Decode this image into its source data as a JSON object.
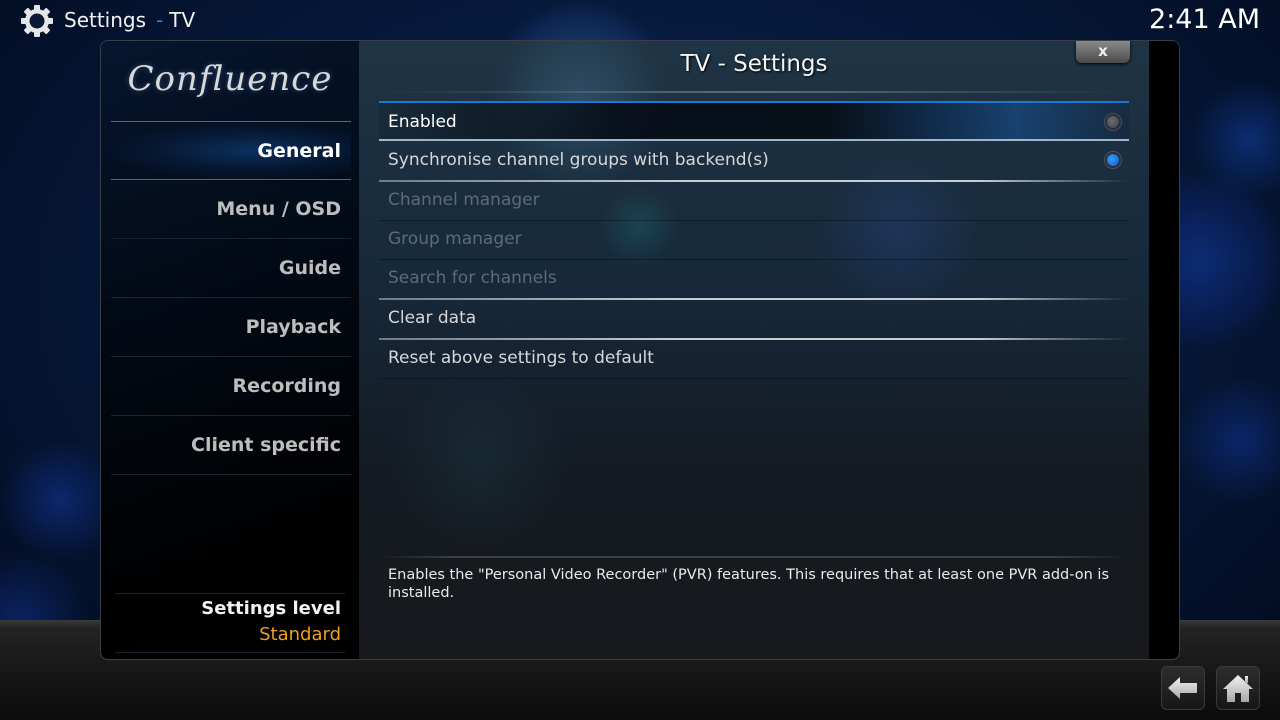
{
  "topbar": {
    "icon": "gear-icon",
    "title": "Settings",
    "separator": "-",
    "subtitle": "TV",
    "clock": "2:41 AM"
  },
  "sidebar": {
    "logo": "Confluence",
    "items": [
      {
        "label": "General",
        "active": true
      },
      {
        "label": "Menu / OSD",
        "active": false
      },
      {
        "label": "Guide",
        "active": false
      },
      {
        "label": "Playback",
        "active": false
      },
      {
        "label": "Recording",
        "active": false
      },
      {
        "label": "Client specific",
        "active": false
      }
    ],
    "settings_level_label": "Settings level",
    "settings_level_value": "Standard"
  },
  "dialog": {
    "title": "TV - Settings",
    "close_label": "x",
    "settings": [
      {
        "label": "Enabled",
        "state": "focused",
        "toggle": "off"
      },
      {
        "label": "Synchronise channel groups with backend(s)",
        "state": "normal",
        "toggle": "on"
      },
      {
        "label": "Channel manager",
        "state": "disabled"
      },
      {
        "label": "Group manager",
        "state": "disabled"
      },
      {
        "label": "Search for channels",
        "state": "disabled"
      },
      {
        "label": "Clear data",
        "state": "normal"
      },
      {
        "label": "Reset above settings to default",
        "state": "normal"
      }
    ],
    "description": "Enables the \"Personal Video Recorder\" (PVR) features. This requires that at least one PVR add-on is installed."
  },
  "bottombar": {
    "back_icon": "back-arrow-icon",
    "home_icon": "home-icon"
  },
  "colors": {
    "accent": "#1a8cf0",
    "level_value": "#eba021",
    "toggle_on": "#1a6fe8",
    "disabled_text": "#5d6b75"
  }
}
